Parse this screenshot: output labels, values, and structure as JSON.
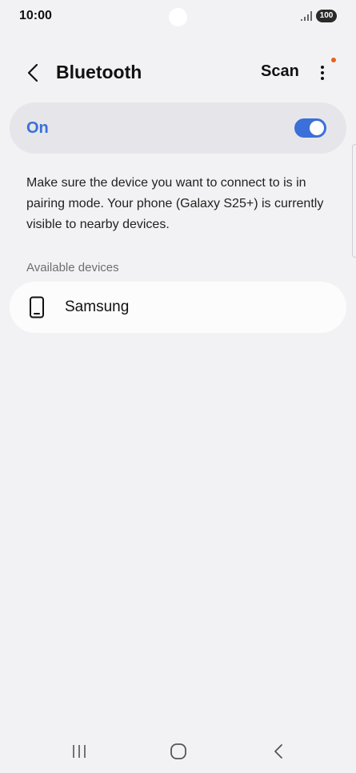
{
  "status_bar": {
    "time": "10:00",
    "battery": "100",
    "icons": [
      "signal-icon",
      "battery-icon"
    ]
  },
  "header": {
    "title": "Bluetooth",
    "scan_label": "Scan",
    "icons": [
      "back-arrow-icon",
      "more-vertical-icon"
    ],
    "notification_dot_color": "#e8611a"
  },
  "toggle": {
    "label": "On",
    "state": "on",
    "accent_color": "#3b6fd9"
  },
  "description": "Make sure the device you want to connect to is in pairing mode. Your phone (Galaxy S25+) is currently visible to nearby devices.",
  "available_devices": {
    "header": "Available devices",
    "items": [
      {
        "name": "Samsung",
        "icon": "phone-icon"
      }
    ]
  },
  "nav_bar": {
    "icons": [
      "recents-icon",
      "home-icon",
      "back-icon"
    ]
  }
}
